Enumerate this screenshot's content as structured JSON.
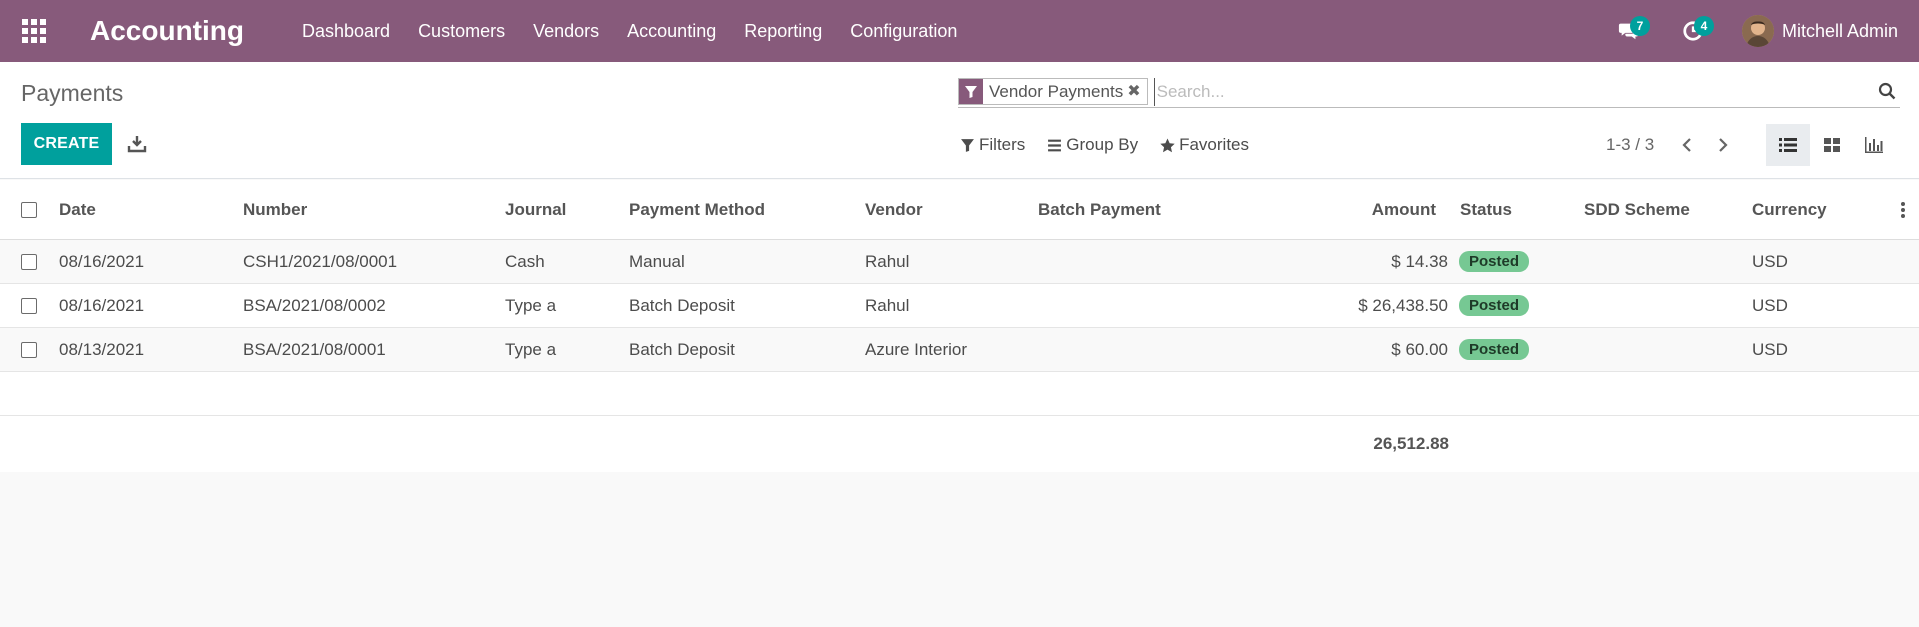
{
  "navbar": {
    "app_name": "Accounting",
    "menu": [
      "Dashboard",
      "Customers",
      "Vendors",
      "Accounting",
      "Reporting",
      "Configuration"
    ],
    "messages_count": "7",
    "activities_count": "4",
    "user_name": "Mitchell Admin",
    "color": "#875a7b"
  },
  "control": {
    "title": "Payments",
    "create_label": "CREATE",
    "facet_label": "Vendor Payments",
    "search_placeholder": "Search...",
    "filters_label": "Filters",
    "groupby_label": "Group By",
    "favorites_label": "Favorites",
    "pager": "1-3 / 3"
  },
  "table": {
    "columns": [
      "Date",
      "Number",
      "Journal",
      "Payment Method",
      "Vendor",
      "Batch Payment",
      "Amount",
      "Status",
      "SDD Scheme",
      "Currency"
    ],
    "rows": [
      {
        "date": "08/16/2021",
        "number": "CSH1/2021/08/0001",
        "journal": "Cash",
        "method": "Manual",
        "vendor": "Rahul",
        "batch": "",
        "amount": "$ 14.38",
        "status": "Posted",
        "sdd": "",
        "currency": "USD"
      },
      {
        "date": "08/16/2021",
        "number": "BSA/2021/08/0002",
        "journal": "Type a",
        "method": "Batch Deposit",
        "vendor": "Rahul",
        "batch": "",
        "amount": "$ 26,438.50",
        "status": "Posted",
        "sdd": "",
        "currency": "USD"
      },
      {
        "date": "08/13/2021",
        "number": "BSA/2021/08/0001",
        "journal": "Type a",
        "method": "Batch Deposit",
        "vendor": "Azure Interior",
        "batch": "",
        "amount": "$ 60.00",
        "status": "Posted",
        "sdd": "",
        "currency": "USD"
      }
    ],
    "total": "26,512.88",
    "accent": "#00a09d"
  }
}
